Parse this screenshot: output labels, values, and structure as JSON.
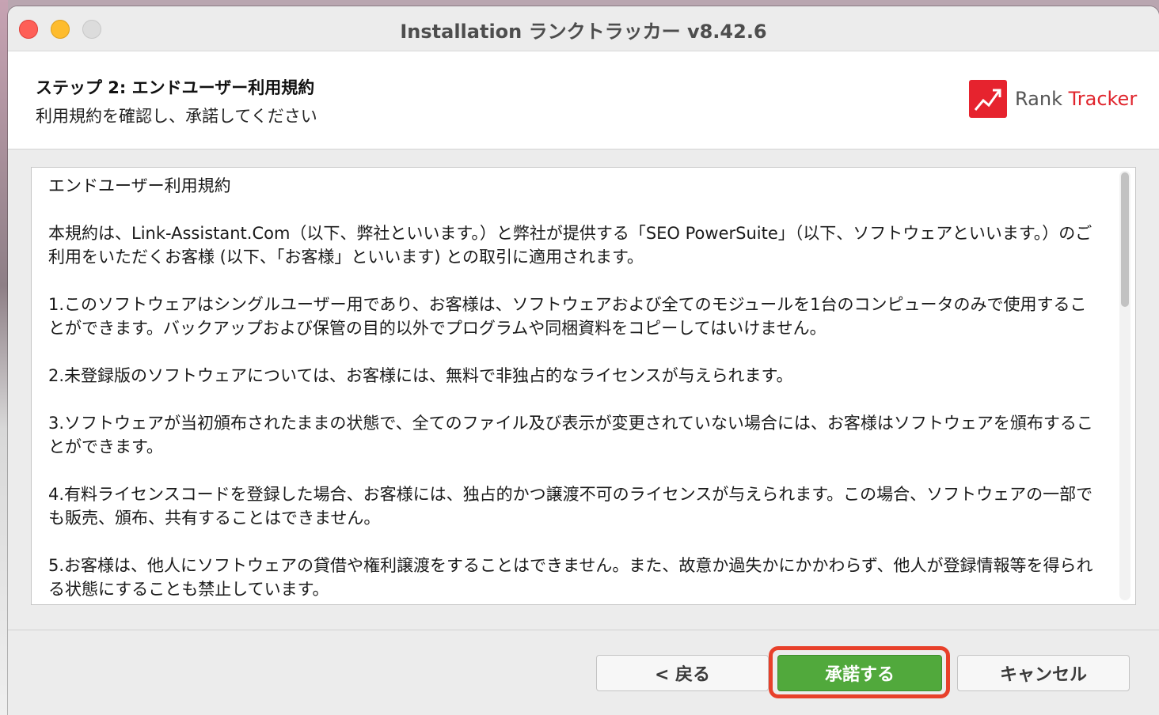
{
  "window": {
    "title": "Installation ランクトラッカー v8.42.6"
  },
  "header": {
    "step_title": "ステップ 2: エンドユーザー利用規約",
    "step_subtitle": "利用規約を確認し、承諾してください",
    "logo": {
      "icon": "rank-tracker-logo-icon",
      "rank": "Rank",
      "tracker": "Tracker",
      "brand_color": "#e6232e"
    }
  },
  "agreement": {
    "paragraphs": [
      "エンドユーザー利用規約",
      "本規約は、Link-Assistant.Com（以下、弊社といいます。）と弊社が提供する「SEO PowerSuite」（以下、ソフトウェアといいます。）のご利用をいただくお客様 (以下、「お客様」といいます) との取引に適用されます。",
      "1.このソフトウェアはシングルユーザー用であり、お客様は、ソフトウェアおよび全てのモジュールを1台のコンピュータのみで使用することができます。バックアップおよび保管の目的以外でプログラムや同梱資料をコピーしてはいけません。",
      "2.未登録版のソフトウェアについては、お客様には、無料で非独占的なライセンスが与えられます。",
      "3.ソフトウェアが当初頒布されたままの状態で、全てのファイル及び表示が変更されていない場合には、お客様はソフトウェアを頒布することができます。",
      "4.有料ライセンスコードを登録した場合、お客様には、独占的かつ譲渡不可のライセンスが与えられます。この場合、ソフトウェアの一部でも販売、頒布、共有することはできません。",
      "5.お客様は、他人にソフトウェアの貸借や権利譲渡をすることはできません。また、故意か過失かにかかわらず、他人が登録情報等を得られる状態にすることも禁止しています。"
    ]
  },
  "buttons": {
    "back": "< 戻る",
    "accept": "承諾する",
    "cancel": "キャンセル",
    "accept_color": "#51a93c",
    "highlight_color": "#e8402a"
  }
}
